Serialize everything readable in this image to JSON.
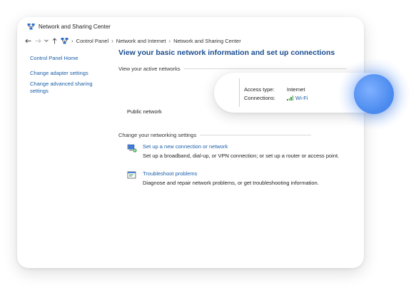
{
  "window": {
    "title": "Network and Sharing Center"
  },
  "address_bar": {
    "breadcrumbs": [
      "Control Panel",
      "Network and Internet",
      "Network and Sharing Center"
    ]
  },
  "sidebar": {
    "items": [
      {
        "label": "Control Panel Home"
      },
      {
        "label": "Change adapter settings"
      },
      {
        "label": "Change advanced sharing settings"
      }
    ]
  },
  "main": {
    "title": "View your basic network information and set up connections",
    "active_networks_header": "View your active networks",
    "network_name": "Public network",
    "access_type_label": "Access type:",
    "access_type_value": "Internet",
    "connections_label": "Connections:",
    "connections_value": "Wi-Fi",
    "settings_header": "Change your networking settings",
    "actions": [
      {
        "link": "Set up a new connection or network",
        "description": "Set up a broadband, dial-up, or VPN connection; or set up a router or access point."
      },
      {
        "link": "Troubleshoot problems",
        "description": "Diagnose and repair network problems, or get troubleshooting information."
      }
    ]
  },
  "colors": {
    "link": "#1a5ea8",
    "title": "#1a4d8f",
    "signal": "#3a9a3a",
    "touch_indicator": "#4f8ef0"
  },
  "icons": {
    "window": "network-sharing-icon",
    "signal": "wifi-signal-icon",
    "setup": "setup-connection-icon",
    "troubleshoot": "troubleshoot-icon"
  }
}
